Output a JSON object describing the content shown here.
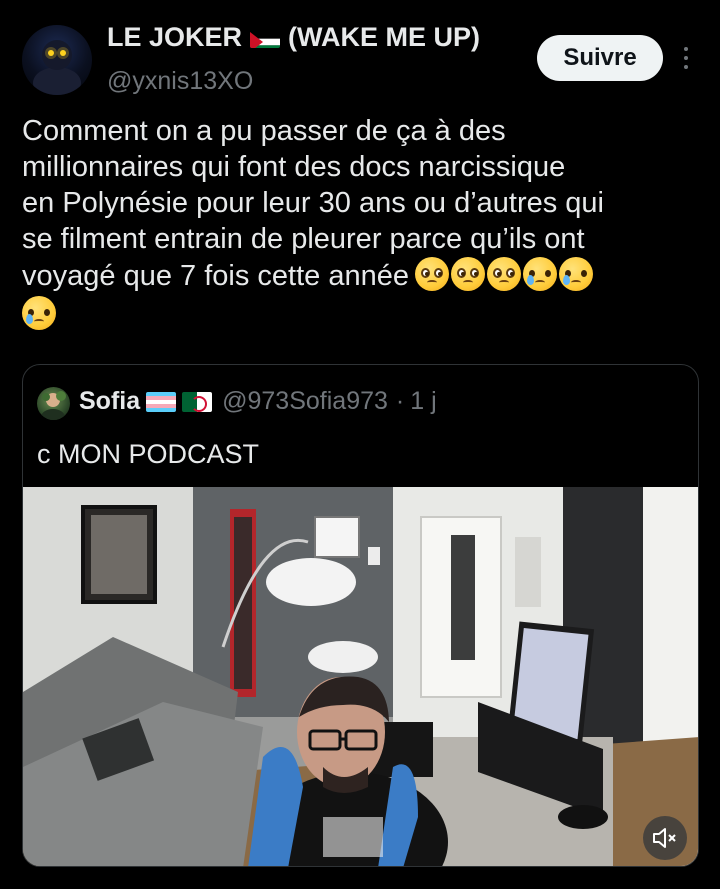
{
  "author": {
    "name": "LE JOKER",
    "name_suffix": "(WAKE ME UP)",
    "flag_icon": "palestine-flag",
    "handle": "@yxnis13XO"
  },
  "follow_label": "Suivre",
  "post": {
    "lines": [
      "Comment on a pu passer de ça à des",
      "millionnaires qui font des docs narcissique",
      "en Polynésie pour leur 30 ans ou d’autres qui",
      "se filment entrain de pleurer parce qu’ils ont",
      "voyagé que 7 fois cette année"
    ],
    "emojis": [
      "pleading-face",
      "pleading-face",
      "pleading-face",
      "crying-face",
      "crying-face",
      "crying-face"
    ]
  },
  "quote": {
    "name": "Sofia",
    "flags": [
      "transgender-flag",
      "algeria-flag"
    ],
    "handle": "@973Sofia973",
    "separator": "·",
    "time": "1 j",
    "text": "c MON PODCAST"
  },
  "video": {
    "muted": true
  },
  "colors": {
    "background": "#000000",
    "text_primary": "#e7e9ea",
    "text_secondary": "#71767b",
    "follow_button_bg": "#eff3f4",
    "border": "#2f3336"
  }
}
